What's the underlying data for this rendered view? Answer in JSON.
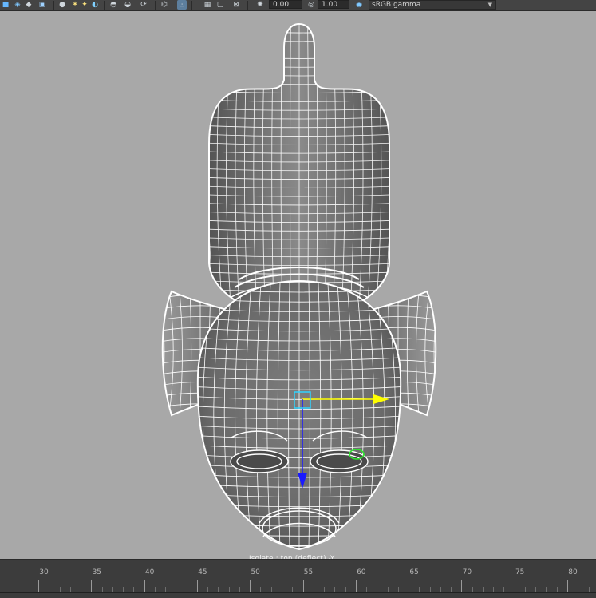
{
  "toolbar": {
    "exposure_value": "0.00",
    "gamma_value": "1.00",
    "color_space": "sRGB gamma",
    "icons": [
      "cube-icon",
      "cube-icon",
      "cube-icon",
      "sphere-icon",
      "light-icon",
      "light-icon",
      "sphere-icon",
      "sphere-icon",
      "sphere-icon",
      "sync-icon",
      "isolate-icon",
      "frame-icon",
      "frame-icon",
      "frame-icon",
      "aperture-icon",
      "exposure-icon",
      "gamma-icon"
    ]
  },
  "viewport": {
    "hud_label": "Isolate : top (deflect) -Y",
    "mesh": "mask",
    "manipulator": {
      "x_axis_color": "#ffff00",
      "y_axis_color": "#1a1aff",
      "center_color": "#2fd3ff"
    }
  },
  "timeline": {
    "tick_labels": [
      "30",
      "35",
      "40",
      "45",
      "50",
      "55",
      "60",
      "65",
      "70",
      "75",
      "80"
    ]
  },
  "colors": {
    "viewport_bg": "#a8a8a8",
    "toolbar_bg": "#444444",
    "timeline_bg": "#3c3c3c",
    "wire": "#ffffff",
    "highlight": "#2ee62e"
  }
}
